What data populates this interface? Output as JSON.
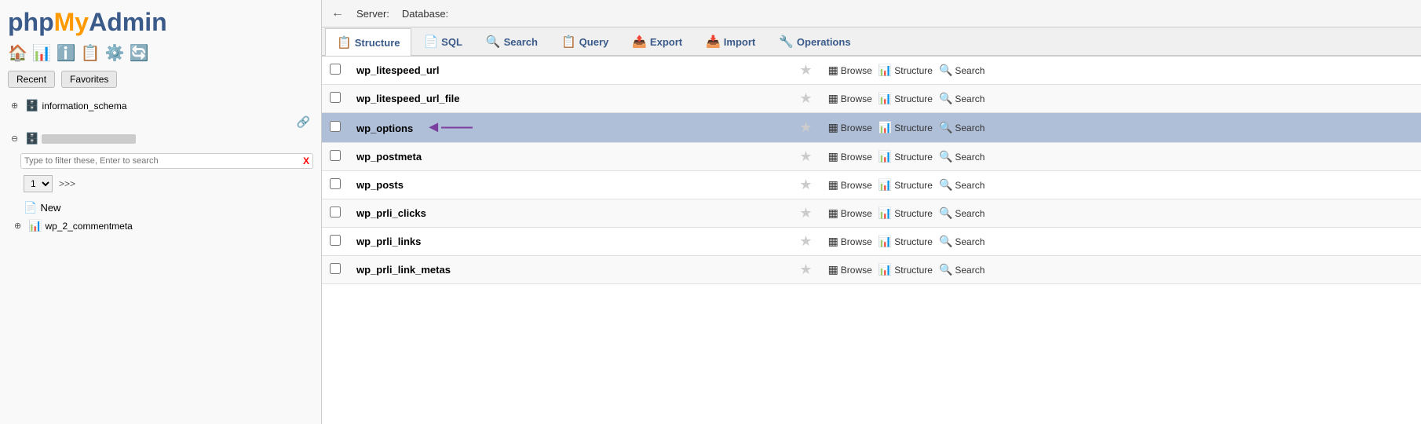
{
  "sidebar": {
    "logo": {
      "php": "php",
      "my": "My",
      "admin": "Admin"
    },
    "nav_buttons": [
      "Recent",
      "Favorites"
    ],
    "tree": {
      "information_schema": "information_schema",
      "current_db_label": ""
    },
    "filter_placeholder": "Type to filter these, Enter to search",
    "clear_label": "X",
    "pagination": {
      "current": "1",
      "arrows": ">>>"
    },
    "new_label": "New",
    "wp2_label": "wp_2_commentmeta"
  },
  "topbar": {
    "back_icon": "←",
    "server_label": "Server:",
    "database_label": "Database:"
  },
  "tabs": [
    {
      "id": "structure",
      "label": "Structure",
      "icon": "📋",
      "active": true
    },
    {
      "id": "sql",
      "label": "SQL",
      "icon": "📄"
    },
    {
      "id": "search",
      "label": "Search",
      "icon": "🔍"
    },
    {
      "id": "query",
      "label": "Query",
      "icon": "📋"
    },
    {
      "id": "export",
      "label": "Export",
      "icon": "📤"
    },
    {
      "id": "import",
      "label": "Import",
      "icon": "📥"
    },
    {
      "id": "operations",
      "label": "Operations",
      "icon": "🔧"
    }
  ],
  "table_rows": [
    {
      "name": "wp_litespeed_url",
      "starred": false,
      "highlighted": false,
      "actions": [
        "Browse",
        "Structure",
        "Search"
      ]
    },
    {
      "name": "wp_litespeed_url_file",
      "starred": false,
      "highlighted": false,
      "actions": [
        "Browse",
        "Structure",
        "Search"
      ]
    },
    {
      "name": "wp_options",
      "starred": false,
      "highlighted": true,
      "actions": [
        "Browse",
        "Structure",
        "Search"
      ],
      "arrow": true
    },
    {
      "name": "wp_postmeta",
      "starred": false,
      "highlighted": false,
      "actions": [
        "Browse",
        "Structure",
        "Search"
      ]
    },
    {
      "name": "wp_posts",
      "starred": false,
      "highlighted": false,
      "actions": [
        "Browse",
        "Structure",
        "Search"
      ]
    },
    {
      "name": "wp_prli_clicks",
      "starred": false,
      "highlighted": false,
      "actions": [
        "Browse",
        "Structure",
        "Search"
      ]
    },
    {
      "name": "wp_prli_links",
      "starred": false,
      "highlighted": false,
      "actions": [
        "Browse",
        "Structure",
        "Search"
      ]
    },
    {
      "name": "wp_prli_link_metas",
      "starred": false,
      "highlighted": false,
      "actions": [
        "Browse",
        "Structure",
        "Search"
      ]
    }
  ],
  "action_icons": {
    "browse": "▦",
    "structure": "📊",
    "search": "🔍"
  }
}
